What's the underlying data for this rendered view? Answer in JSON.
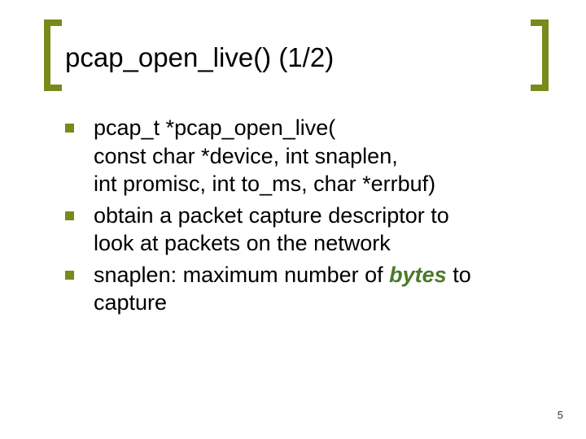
{
  "title": "pcap_open_live() (1/2)",
  "bullets": [
    {
      "lines": [
        "pcap_t *pcap_open_live(",
        "const char *device, int snaplen,",
        "int promisc, int to_ms, char *errbuf)"
      ]
    },
    {
      "lines": [
        "obtain a packet capture descriptor to",
        "look at packets on the network"
      ]
    },
    {
      "lines_rich": [
        [
          {
            "t": "snaplen: maximum number of "
          },
          {
            "t": "bytes",
            "em": true
          },
          {
            "t": " to"
          }
        ],
        [
          {
            "t": "capture"
          }
        ]
      ]
    }
  ],
  "page_number": "5"
}
